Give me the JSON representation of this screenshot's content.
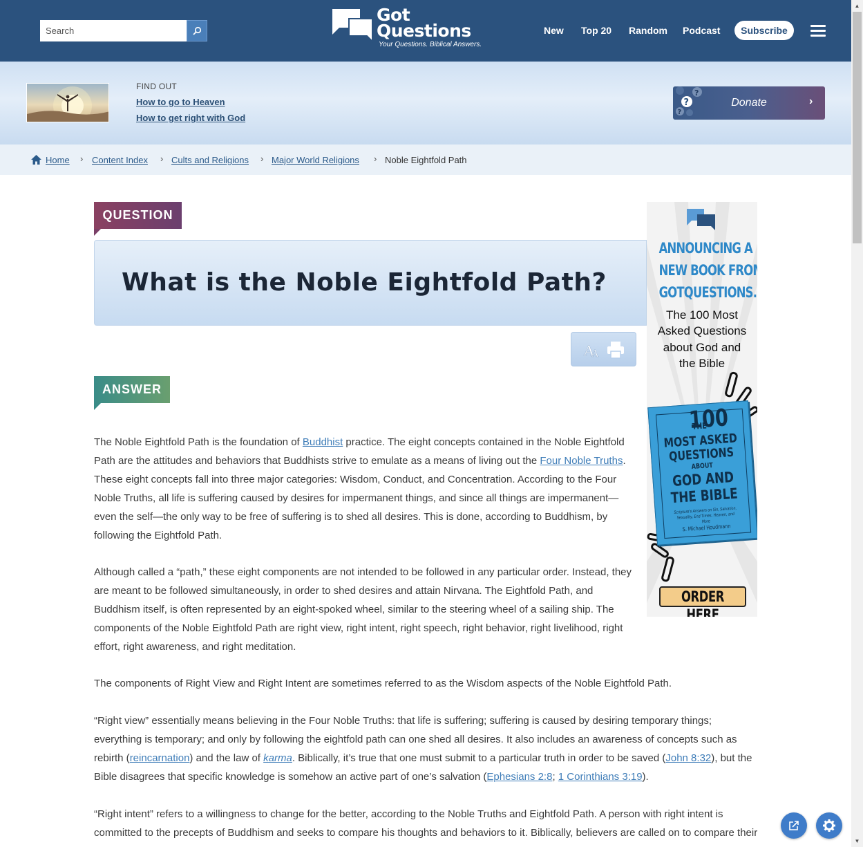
{
  "header": {
    "search_placeholder": "Search",
    "logo": {
      "title_line1": "Got",
      "title_line2": "Questions",
      "tagline": "Your Questions. Biblical Answers."
    },
    "nav": [
      "New",
      "Top 20",
      "Random",
      "Podcast"
    ],
    "subscribe_label": "Subscribe"
  },
  "find_out": {
    "label": "FIND OUT",
    "links": [
      "How to go to Heaven",
      "How to get right with God"
    ],
    "donate_label": "Donate"
  },
  "breadcrumb": [
    "Home",
    "Content Index",
    "Cults and Religions",
    "Major World Religions",
    "Noble Eightfold Path"
  ],
  "question": {
    "tag": "QUESTION",
    "title": "What is the Noble Eightfold Path?"
  },
  "answer": {
    "tag": "ANSWER",
    "p1": {
      "t1": "The Noble Eightfold Path is the foundation of ",
      "l1": "Buddhist",
      "t2": " practice. The eight concepts contained in the Noble Eightfold Path are the attitudes and behaviors that Buddhists strive to emulate as a means of living out the ",
      "l2": "Four Noble Truths",
      "t3": ". These eight concepts fall into three major categories: Wisdom, Conduct, and Concentration. According to the Four Noble Truths, all life is suffering caused by desires for impermanent things, and since all things are impermanent—even the self—the only way to be free of suffering is to shed all desires. This is done, according to Buddhism, by following the Eightfold Path."
    },
    "p2": "Although called a “path,” these eight components are not intended to be followed in any particular order. Instead, they are meant to be followed simultaneously, in order to shed desires and attain Nirvana. The Eightfold Path, and Buddhism itself, is often represented by an eight-spoked wheel, similar to the steering wheel of a sailing ship. The components of the Noble Eightfold Path are right view, right intent, right speech, right behavior, right livelihood, right effort, right awareness, and right meditation.",
    "p3": "The components of Right View and Right Intent are sometimes referred to as the Wisdom aspects of the Noble Eightfold Path.",
    "p4": {
      "t1": "“Right view” essentially means believing in the Four Noble Truths: that life is suffering; suffering is caused by desiring temporary things; everything is temporary; and only by following the eightfold path can one shed all desires. It also includes an awareness of concepts such as rebirth (",
      "l1": "reincarnation",
      "t2": ") and the law of ",
      "l2": "karma",
      "t3": ". Biblically, it’s true that one must submit to a particular truth in order to be saved (",
      "l3": "John 8:32",
      "t4": "), but the Bible disagrees that specific knowledge is somehow an active part of one’s salvation (",
      "l4": "Ephesians 2:8",
      "t5": "; ",
      "l5": "1 Corinthians 3:19",
      "t6": ")."
    },
    "p5": "“Right intent” refers to a willingness to change for the better, according to the Noble Truths and Eightfold Path. A person with right intent is committed to the precepts of Buddhism and seeks to compare his thoughts and behaviors to it. Biblically, believers are called on to compare their feelings, ideas, words, and deeds of God’s Word in this same way. However, Scripture also recognizes that everyone is vulnerable to deception and needs guidance."
  },
  "ad": {
    "headline": [
      "ANNOUNCING A",
      "NEW BOOK FROM",
      "GOTQUESTIONS.ORG"
    ],
    "sub": [
      "The 100 Most",
      "Asked Questions",
      "about God and",
      "the Bible"
    ],
    "book": {
      "the": "THE",
      "num": "100",
      "l1": "MOST ASKED",
      "l2": "QUESTIONS",
      "about": "ABOUT",
      "l3": "GOD AND",
      "l4": "THE BIBLE",
      "subtitle": "Scripture's Answers on Sin, Salvation, Sexuality, End Times, Heaven, and More",
      "author": "S. Michael Houdmann"
    },
    "cta": "ORDER HERE"
  },
  "colors": {
    "header_bg": "#2b527e",
    "question_tag": "#7a4068",
    "answer_tag": "#4a9583",
    "link": "#3f7db8",
    "fab": "#3f7cc9"
  }
}
